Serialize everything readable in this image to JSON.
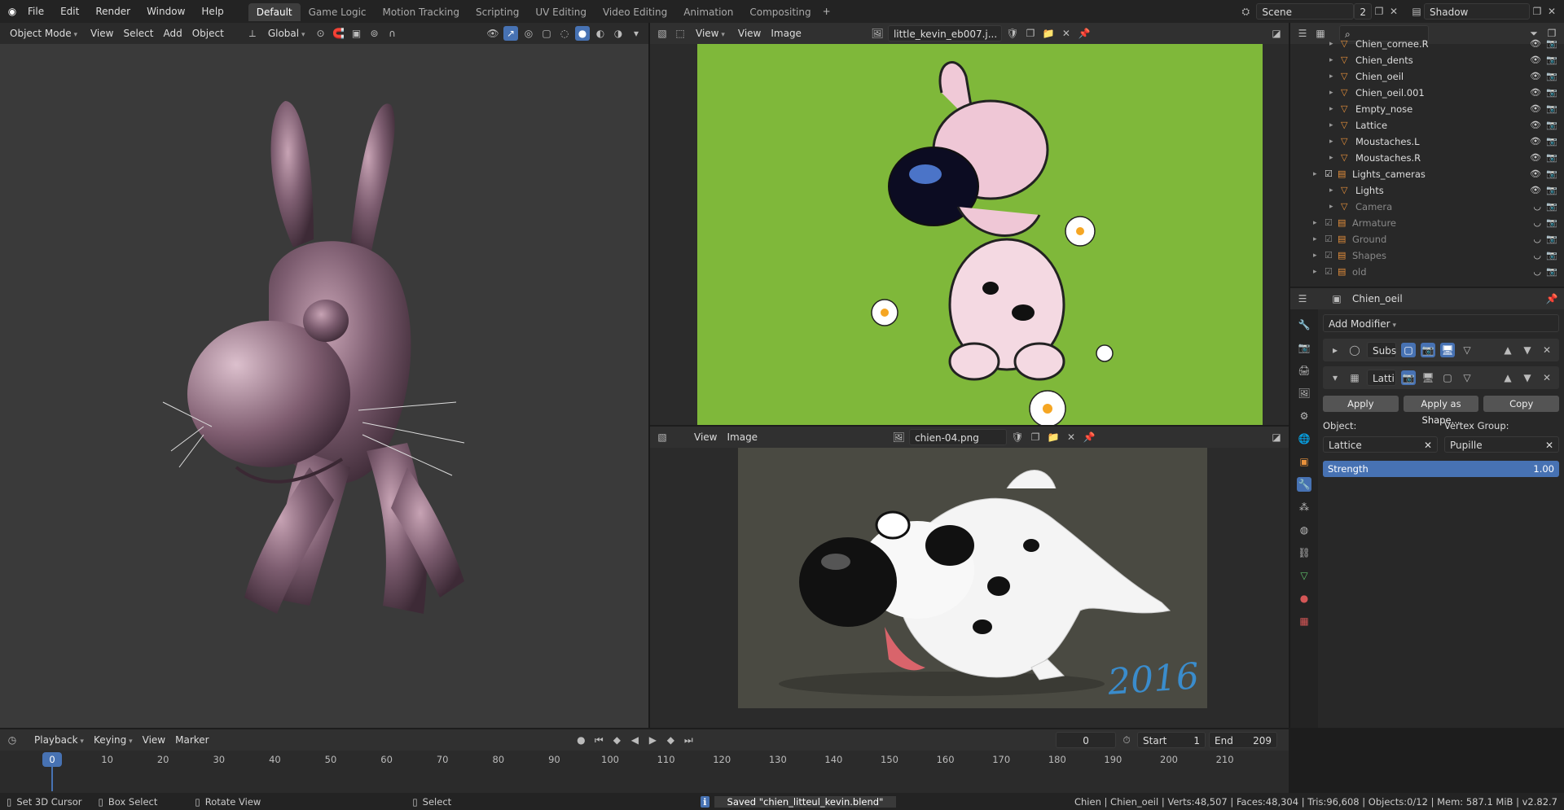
{
  "topbar": {
    "menus": [
      "File",
      "Edit",
      "Render",
      "Window",
      "Help"
    ],
    "workspaces": [
      "Default",
      "Game Logic",
      "Motion Tracking",
      "Scripting",
      "UV Editing",
      "Video Editing",
      "Animation",
      "Compositing"
    ],
    "scene_label": "Scene",
    "scene_users": "2",
    "view_layer": "Shadow"
  },
  "viewport": {
    "mode": "Object Mode",
    "menus": [
      "View",
      "Select",
      "Add",
      "Object"
    ],
    "orientation": "Global"
  },
  "image_editor_top": {
    "view_label": "View",
    "menus": [
      "View",
      "Image"
    ],
    "image_name": "little_kevin_eb007.j..."
  },
  "image_editor_bottom": {
    "menus": [
      "View",
      "Image"
    ],
    "image_name": "chien-04.png",
    "signature": "2016"
  },
  "outliner": {
    "rows": [
      {
        "label": "Chien_cornee.R",
        "indent": 2,
        "dim": false
      },
      {
        "label": "Chien_dents",
        "indent": 2,
        "dim": false
      },
      {
        "label": "Chien_oeil",
        "indent": 2,
        "dim": false
      },
      {
        "label": "Chien_oeil.001",
        "indent": 2,
        "dim": false
      },
      {
        "label": "Empty_nose",
        "indent": 2,
        "dim": false
      },
      {
        "label": "Lattice",
        "indent": 2,
        "dim": false
      },
      {
        "label": "Moustaches.L",
        "indent": 2,
        "dim": false
      },
      {
        "label": "Moustaches.R",
        "indent": 2,
        "dim": false
      },
      {
        "label": "Lights_cameras",
        "indent": 1,
        "dim": false
      },
      {
        "label": "Lights",
        "indent": 2,
        "dim": false
      },
      {
        "label": "Camera",
        "indent": 2,
        "dim": true
      },
      {
        "label": "Armature",
        "indent": 1,
        "dim": true
      },
      {
        "label": "Ground",
        "indent": 1,
        "dim": true
      },
      {
        "label": "Shapes",
        "indent": 1,
        "dim": true
      },
      {
        "label": "old",
        "indent": 1,
        "dim": true
      }
    ]
  },
  "properties": {
    "object_name": "Chien_oeil",
    "add_modifier": "Add Modifier",
    "modifiers": [
      {
        "name": "Subs",
        "expanded": false
      },
      {
        "name": "Latti",
        "expanded": true
      }
    ],
    "apply": "Apply",
    "apply_as_shape": "Apply as Shape...",
    "copy": "Copy",
    "object_label": "Object:",
    "object_value": "Lattice",
    "vgroup_label": "Vertex Group:",
    "vgroup_value": "Pupille",
    "strength_label": "Strength",
    "strength_value": "1.00"
  },
  "timeline": {
    "menus": [
      "Playback",
      "Keying",
      "View",
      "Marker"
    ],
    "current_frame": "0",
    "start_label": "Start",
    "start_value": "1",
    "end_label": "End",
    "end_value": "209",
    "ticks": [
      "0",
      "10",
      "20",
      "30",
      "40",
      "50",
      "60",
      "70",
      "80",
      "90",
      "100",
      "110",
      "120",
      "130",
      "140",
      "150",
      "160",
      "170",
      "180",
      "190",
      "200",
      "210"
    ]
  },
  "statusbar": {
    "hint1": "Set 3D Cursor",
    "hint2": "Box Select",
    "hint3": "Rotate View",
    "hint4": "Select",
    "message": "Saved \"chien_litteul_kevin.blend\"",
    "stats": "Chien | Chien_oeil | Verts:48,507 | Faces:48,304 | Tris:96,608 | Objects:0/12 | Mem: 587.1 MiB | v2.82.7"
  },
  "colors": {
    "accent": "#4772b3",
    "green_bg": "#7fb83a",
    "render_bg": "#4a4a42"
  }
}
